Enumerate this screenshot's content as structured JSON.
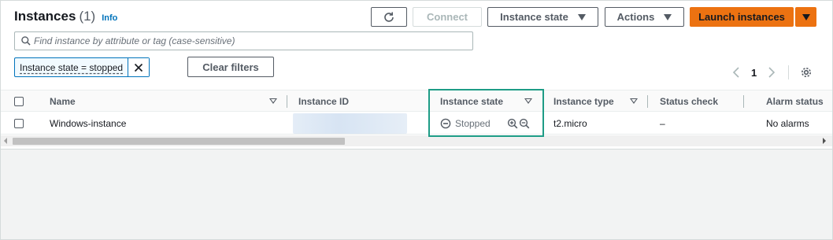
{
  "header": {
    "title": "Instances",
    "count": "(1)",
    "info_link": "Info"
  },
  "toolbar": {
    "refresh_icon": "refresh-icon",
    "connect_label": "Connect",
    "instance_state_label": "Instance state",
    "actions_label": "Actions",
    "launch_label": "Launch instances"
  },
  "search": {
    "placeholder": "Find instance by attribute or tag (case-sensitive)",
    "value": ""
  },
  "filter": {
    "token_label": "Instance state = stopped",
    "clear_label": "Clear filters"
  },
  "pagination": {
    "current_page": "1"
  },
  "table": {
    "columns": [
      "Name",
      "Instance ID",
      "Instance state",
      "Instance type",
      "Status check",
      "Alarm status"
    ],
    "rows": [
      {
        "name": "Windows-instance",
        "instance_id": "",
        "state": "Stopped",
        "type": "t2.micro",
        "status_check": "–",
        "alarm_status": "No alarms"
      }
    ]
  },
  "colors": {
    "primary": "#ec7211",
    "link": "#0073bb",
    "highlight": "#1e9c86"
  }
}
